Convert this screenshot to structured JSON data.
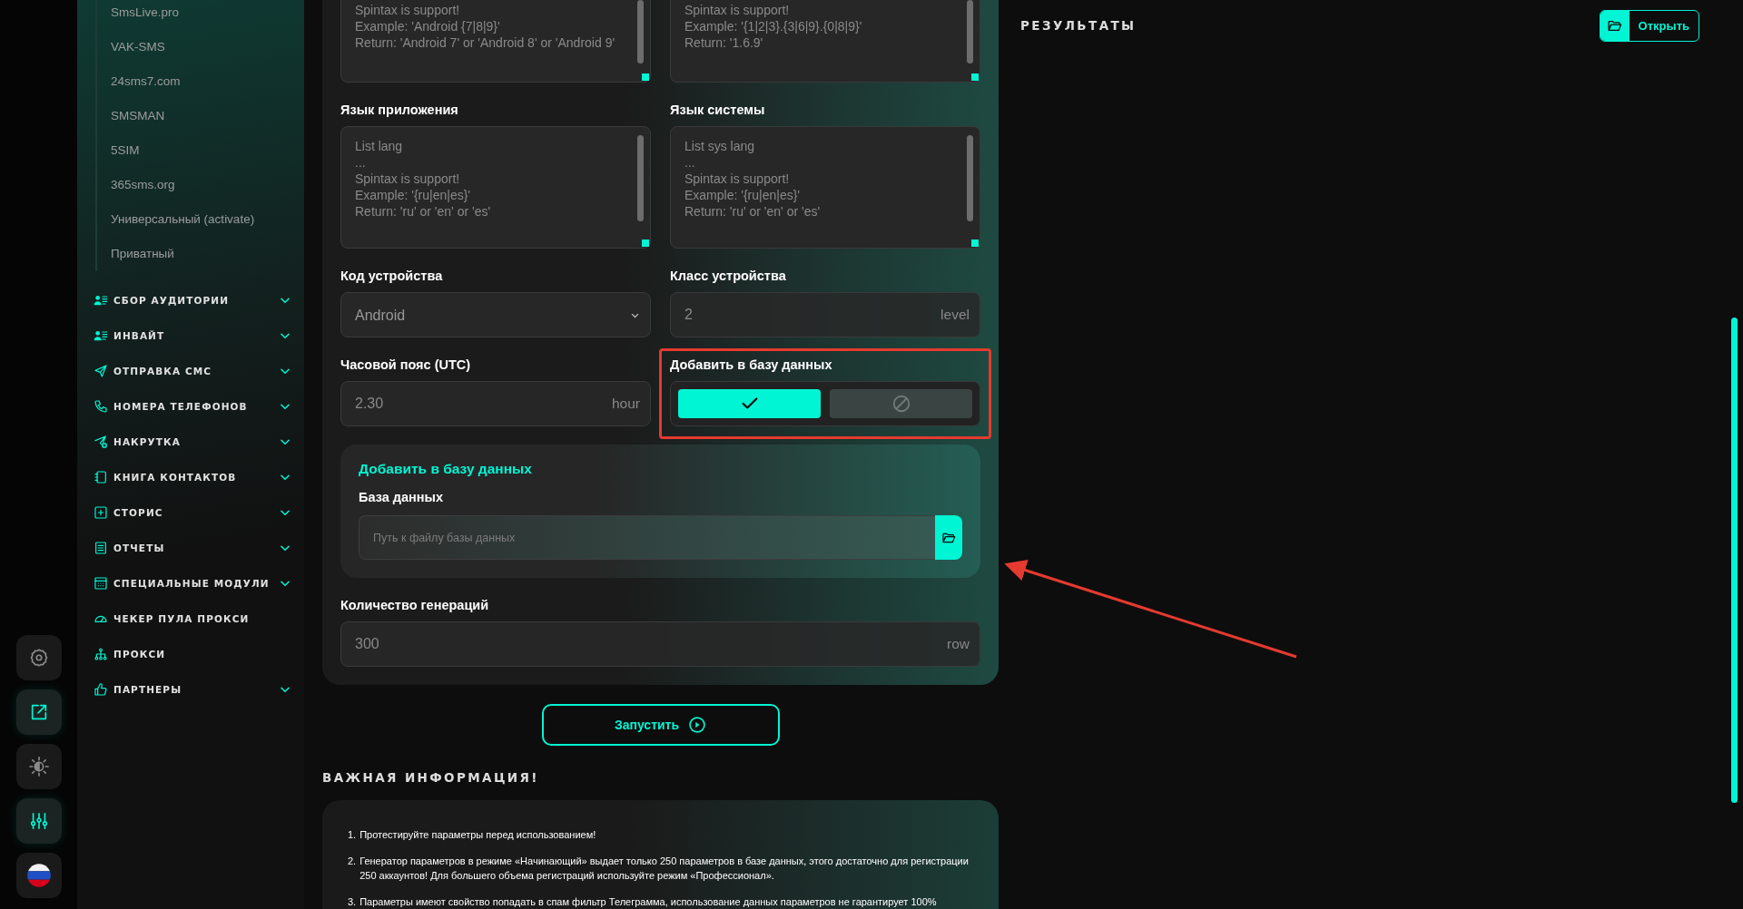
{
  "rail": [
    {
      "kind": "settings",
      "active": false
    },
    {
      "kind": "external",
      "active": true
    },
    {
      "kind": "theme",
      "active": false
    },
    {
      "kind": "sliders",
      "active": true
    },
    {
      "kind": "flag",
      "active": false
    }
  ],
  "sidebar": {
    "sub_items": [
      "SmsLive.pro",
      "VAK-SMS",
      "24sms7.com",
      "SMSMAN",
      "5SIM",
      "365sms.org",
      "Универсальный (activate)",
      "Приватный"
    ],
    "sections": [
      {
        "kind": "audience",
        "label": "СБОР АУДИТОРИИ",
        "collapsible": true
      },
      {
        "kind": "audience",
        "label": "ИНВАЙТ",
        "collapsible": true
      },
      {
        "kind": "send",
        "label": "ОТПРАВКА СМС",
        "collapsible": true
      },
      {
        "kind": "phone",
        "label": "НОМЕРА ТЕЛЕФОНОВ",
        "collapsible": true
      },
      {
        "kind": "boost",
        "label": "НАКРУТКА",
        "collapsible": true
      },
      {
        "kind": "contacts",
        "label": "КНИГА КОНТАКТОВ",
        "collapsible": true
      },
      {
        "kind": "stories",
        "label": "СТОРИС",
        "collapsible": true
      },
      {
        "kind": "reports",
        "label": "ОТЧЕТЫ",
        "collapsible": true
      },
      {
        "kind": "modules",
        "label": "СПЕЦИАЛЬНЫЕ МОДУЛИ",
        "collapsible": true
      },
      {
        "kind": "gauge",
        "label": "ЧЕКЕР ПУЛА ПРОКСИ",
        "collapsible": false
      },
      {
        "kind": "network",
        "label": "ПРОКСИ",
        "collapsible": false
      },
      {
        "kind": "thumb",
        "label": "ПАРТНЕРЫ",
        "collapsible": true
      }
    ]
  },
  "form": {
    "top_textareas": [
      {
        "placeholder": "Spintax is support!\nExample: 'Android {7|8|9}'\nReturn: 'Android 7' or 'Android 8' or 'Android 9'"
      },
      {
        "placeholder": "Spintax is support!\nExample: '{1|2|3}.{3|6|9}.{0|8|9}'\nReturn: '1.6.9'"
      }
    ],
    "fields": [
      {
        "kind": "textarea",
        "label": "Язык приложения",
        "placeholder": "List lang\n...\nSpintax is support!\nExample: '{ru|en|es}'\nReturn: 'ru' or 'en' or 'es'"
      },
      {
        "kind": "textarea",
        "label": "Язык системы",
        "placeholder": "List sys lang\n...\nSpintax is support!\nExample: '{ru|en|es}'\nReturn: 'ru' or 'en' or 'es'"
      },
      {
        "kind": "select",
        "label": "Код устройства",
        "value": "Android"
      },
      {
        "kind": "input",
        "label": "Класс устройства",
        "placeholder": "2",
        "unit": "level"
      },
      {
        "kind": "input",
        "label": "Часовой пояс (UTC)",
        "placeholder": "2.30",
        "unit": "hour"
      },
      {
        "kind": "toggle",
        "label": "Добавить в базу данных",
        "highlighted": true,
        "options": [
          {
            "kind": "check",
            "selected": true
          },
          {
            "kind": "block",
            "selected": false
          }
        ]
      }
    ],
    "database_card": {
      "title": "Добавить в базу данных",
      "label": "База данных",
      "placeholder": "Путь к файлу базы данных",
      "annotated": true
    },
    "count_field": {
      "label": "Количество генераций",
      "placeholder": "300",
      "unit": "row"
    }
  },
  "run_button": {
    "label": "Запустить"
  },
  "info": {
    "title": "ВАЖНАЯ ИНФОРМАЦИЯ!",
    "items": [
      {
        "number": "1.",
        "text": "Протестируйте параметры перед использованием!"
      },
      {
        "number": "2.",
        "text": "Генератор параметров в режиме «Начинающий» выдает только 250 параметров в базе данных, этого достаточно для регистрации 250 аккаунтов! Для большего объема регистраций используйте режим «Профессионал»."
      },
      {
        "number": "3.",
        "text": "Параметры имеют свойство попадать в спам фильтр Телеграмма, использование данных параметров не гарантирует 100%"
      }
    ]
  },
  "results": {
    "title": "РЕЗУЛЬТАТЫ",
    "open_button": "Открыть"
  }
}
